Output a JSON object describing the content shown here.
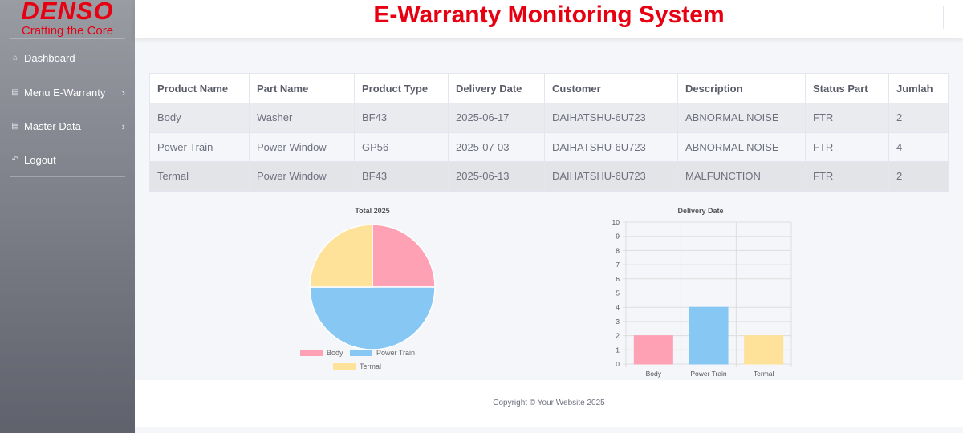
{
  "brand": {
    "logo": "DENSO",
    "tagline": "Crafting the Core"
  },
  "sidebar": {
    "items": [
      {
        "label": "Dashboard",
        "icon": "home-icon",
        "has_submenu": false
      },
      {
        "label": "Menu E-Warranty",
        "icon": "table-icon",
        "has_submenu": true
      },
      {
        "label": "Master Data",
        "icon": "table-icon",
        "has_submenu": true
      },
      {
        "label": "Logout",
        "icon": "reply-icon",
        "has_submenu": false
      }
    ]
  },
  "header": {
    "title": "E-Warranty Monitoring System"
  },
  "table": {
    "columns": [
      "Product Name",
      "Part Name",
      "Product Type",
      "Delivery Date",
      "Customer",
      "Description",
      "Status Part",
      "Jumlah"
    ],
    "rows": [
      [
        "Body",
        "Washer",
        "BF43",
        "2025-06-17",
        "DAIHATSHU-6U723",
        "ABNORMAL NOISE",
        "FTR",
        "2"
      ],
      [
        "Power Train",
        "Power Window",
        "GP56",
        "2025-07-03",
        "DAIHATSHU-6U723",
        "ABNORMAL NOISE",
        "FTR",
        "4"
      ],
      [
        "Termal",
        "Power Window",
        "BF43",
        "2025-06-13",
        "DAIHATSHU-6U723",
        "MALFUNCTION",
        "FTR",
        "2"
      ]
    ]
  },
  "chart_data": [
    {
      "type": "pie",
      "title": "Total 2025",
      "categories": [
        "Body",
        "Power Train",
        "Termal"
      ],
      "values": [
        2,
        4,
        2
      ],
      "colors": [
        "#ffa1b5",
        "#86c7f3",
        "#ffe29a"
      ],
      "legend": "bottom"
    },
    {
      "type": "bar",
      "title": "Delivery Date",
      "categories": [
        "Body",
        "Power Train",
        "Termal"
      ],
      "values": [
        2,
        4,
        2
      ],
      "colors": [
        "#ffa1b5",
        "#86c7f3",
        "#ffe29a"
      ],
      "ylim": [
        0,
        10
      ],
      "yticks": [
        "0",
        "1",
        "2",
        "3",
        "4",
        "5",
        "6",
        "7",
        "8",
        "9",
        "10"
      ],
      "grid": true
    }
  ],
  "footer": {
    "text": "Copyright © Your Website 2025"
  }
}
